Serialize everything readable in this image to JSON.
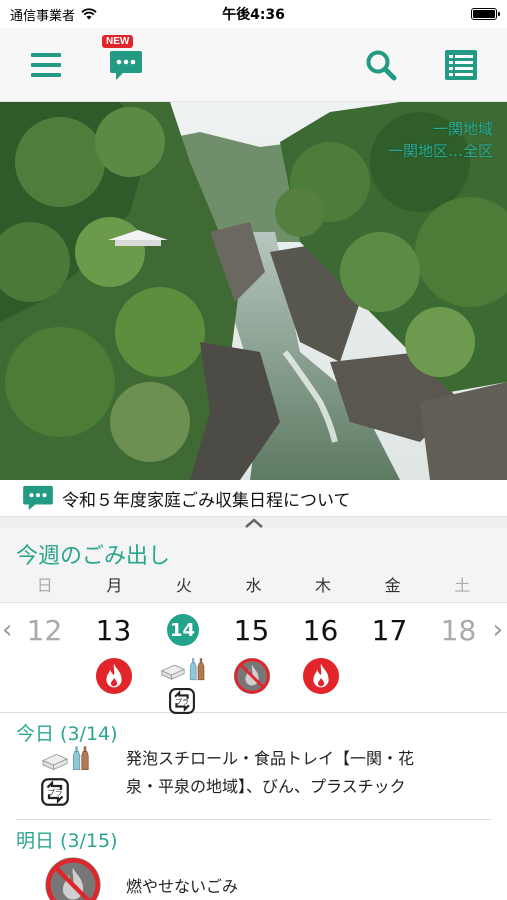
{
  "status_bar": {
    "carrier": "通信事業者",
    "time": "午後4:36"
  },
  "toolbar": {
    "new_badge": "NEW"
  },
  "region": {
    "area": "一関地域",
    "district": "一関地区…全区"
  },
  "notice": {
    "text": "令和５年度家庭ごみ収集日程について"
  },
  "week": {
    "title": "今週のごみ出し",
    "weekdays": [
      "日",
      "月",
      "火",
      "水",
      "木",
      "金",
      "土"
    ],
    "days": [
      {
        "num": "12",
        "dim": true,
        "today": false,
        "icons": []
      },
      {
        "num": "13",
        "dim": false,
        "today": false,
        "icons": [
          "burnable-icon"
        ]
      },
      {
        "num": "14",
        "dim": false,
        "today": true,
        "icons": [
          "styrofoam-icon",
          "bottle-icon",
          "plastic-recycle-icon"
        ]
      },
      {
        "num": "15",
        "dim": false,
        "today": false,
        "icons": [
          "non-burnable-icon"
        ]
      },
      {
        "num": "16",
        "dim": false,
        "today": false,
        "icons": [
          "burnable-icon"
        ]
      },
      {
        "num": "17",
        "dim": false,
        "today": false,
        "icons": []
      },
      {
        "num": "18",
        "dim": true,
        "today": false,
        "icons": []
      }
    ]
  },
  "today": {
    "title": "今日 (3/14)",
    "text_line1": "発泡スチロール・食品トレイ【一関・花",
    "text_line2": "泉・平泉の地域】、びん、プラスチック"
  },
  "tomorrow": {
    "title": "明日 (3/15)",
    "text": "燃やせないごみ"
  },
  "colors": {
    "accent": "#2aa68f",
    "fire": "#e2242b",
    "today_circle": "#23a38b"
  }
}
